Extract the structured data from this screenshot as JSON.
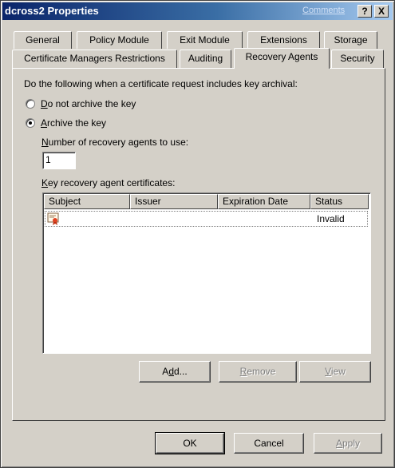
{
  "window": {
    "title": "dcross2 Properties",
    "comments_link": "Comments",
    "help_button": "?",
    "close_button": "X"
  },
  "tabs": {
    "row_back": [
      {
        "label": "General"
      },
      {
        "label": "Policy Module"
      },
      {
        "label": "Exit Module"
      },
      {
        "label": "Extensions"
      },
      {
        "label": "Storage"
      }
    ],
    "row_front": [
      {
        "label": "Certificate Managers Restrictions"
      },
      {
        "label": "Auditing"
      },
      {
        "label": "Recovery Agents",
        "active": true
      },
      {
        "label": "Security"
      }
    ]
  },
  "recovery": {
    "instruction": "Do the following when a certificate request includes key archival:",
    "option_no_archive": {
      "pre": "",
      "key": "D",
      "post": "o not archive the key",
      "selected": false
    },
    "option_archive": {
      "pre": "",
      "key": "A",
      "post": "rchive the key",
      "selected": true
    },
    "agents_label": {
      "pre": "",
      "key": "N",
      "post": "umber of recovery agents to use:"
    },
    "agents_value": "1",
    "certs_label": {
      "pre": "",
      "key": "K",
      "post": "ey recovery agent certificates:"
    },
    "columns": [
      "Subject",
      "Issuer",
      "Expiration Date",
      "Status"
    ],
    "rows": [
      {
        "icon": "certificate-icon",
        "subject": "",
        "issuer": "",
        "expiration": "",
        "status": "Invalid"
      }
    ]
  },
  "list_buttons": {
    "add": {
      "pre": "A",
      "key": "d",
      "post": "d..."
    },
    "remove": {
      "pre": "",
      "key": "R",
      "post": "emove"
    },
    "view": {
      "pre": "",
      "key": "V",
      "post": "iew"
    }
  },
  "dialog_buttons": {
    "ok": "OK",
    "cancel": "Cancel",
    "apply": {
      "pre": "",
      "key": "A",
      "post": "pply"
    }
  }
}
